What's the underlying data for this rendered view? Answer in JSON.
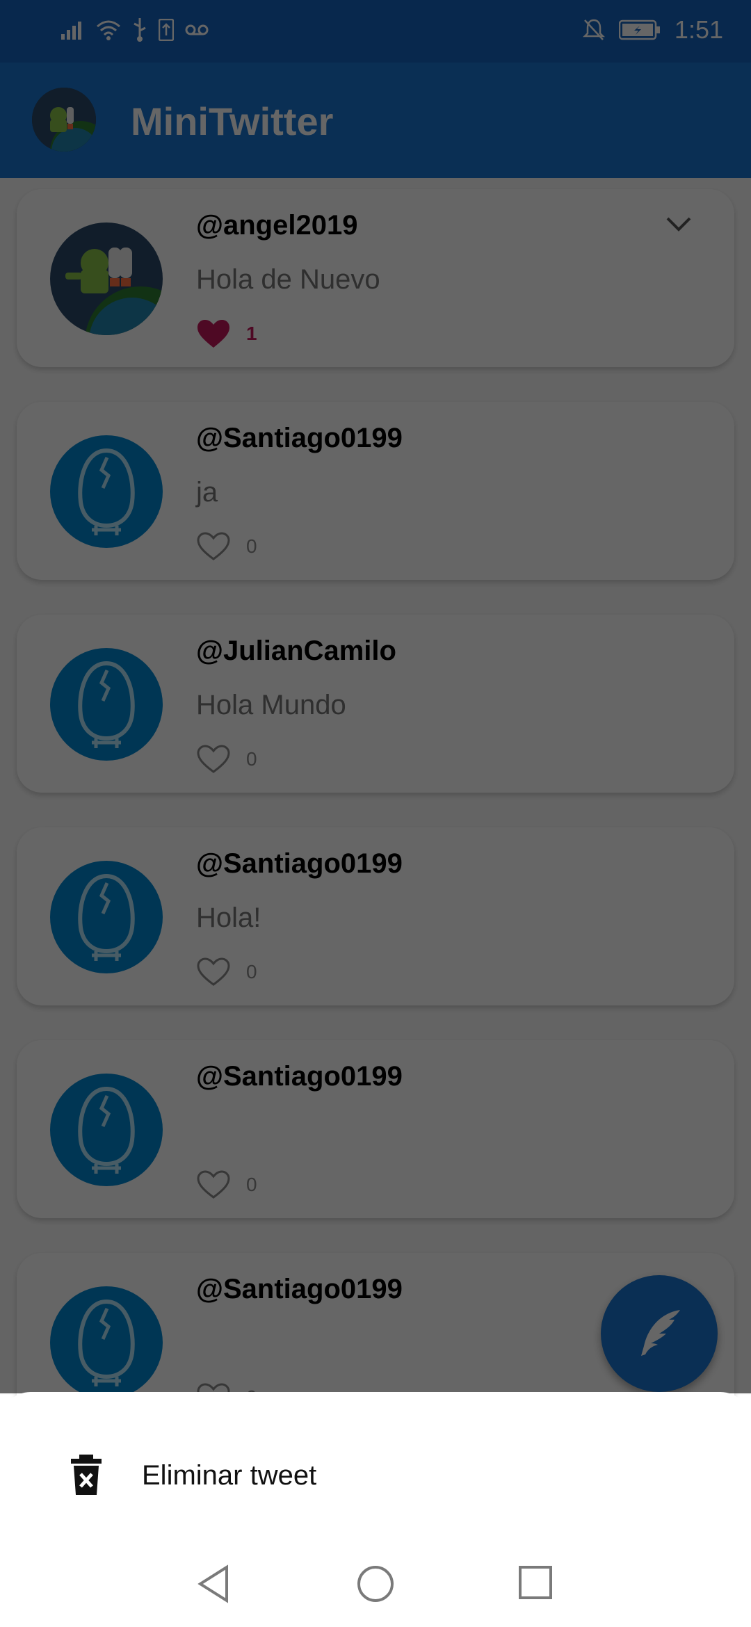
{
  "status_bar": {
    "time": "1:51",
    "icons_left": [
      "signal-icon",
      "wifi-icon",
      "usb-icon",
      "sim-upload-icon",
      "voicemail-icon"
    ],
    "icons_right": [
      "notifications-off-icon",
      "battery-charging-icon"
    ]
  },
  "app_bar": {
    "title": "MiniTwitter"
  },
  "tweets": [
    {
      "handle": "@angel2019",
      "message": "Hola de Nuevo",
      "likes": "1",
      "liked": true,
      "avatar": "android-jetpack"
    },
    {
      "handle": "@Santiago0199",
      "message": "ja",
      "likes": "0",
      "liked": false,
      "avatar": "egg"
    },
    {
      "handle": "@JulianCamilo",
      "message": "Hola Mundo",
      "likes": "0",
      "liked": false,
      "avatar": "egg"
    },
    {
      "handle": "@Santiago0199",
      "message": "Hola!",
      "likes": "0",
      "liked": false,
      "avatar": "egg"
    },
    {
      "handle": "@Santiago0199",
      "message": "",
      "likes": "0",
      "liked": false,
      "avatar": "egg"
    },
    {
      "handle": "@Santiago0199",
      "message": "",
      "likes": "0",
      "liked": false,
      "avatar": "egg"
    }
  ],
  "bottom_sheet": {
    "delete_label": "Eliminar tweet"
  },
  "colors": {
    "primary": "#1976d2",
    "primary_dark": "#1565c0",
    "like": "#c2185b",
    "egg_bg": "#0288d1"
  }
}
